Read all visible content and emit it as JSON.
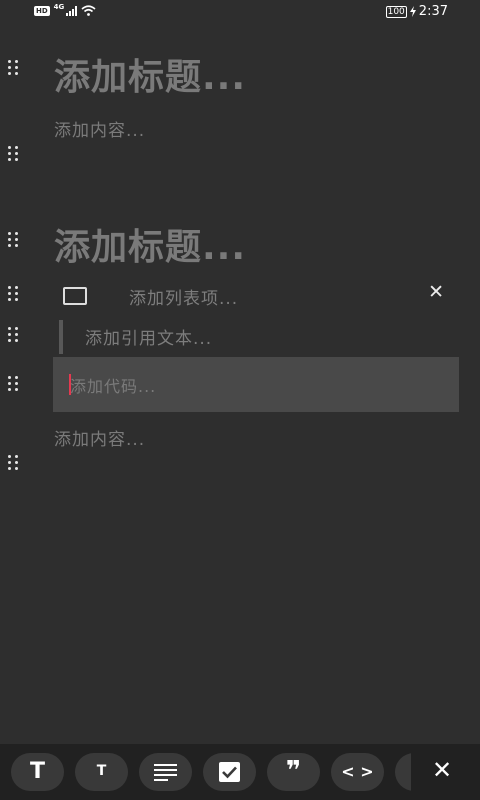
{
  "status_bar": {
    "hd": "HD",
    "network": "4G",
    "battery": "100",
    "time": "2:37"
  },
  "editor": {
    "heading_1": "添加标题...",
    "paragraph_1": "添加内容...",
    "heading_2": "添加标题...",
    "list_item": "添加列表项...",
    "quote": "添加引用文本...",
    "code": "添加代码...",
    "paragraph_2": "添加内容..."
  },
  "toolbar": {
    "heading_large": "T",
    "heading_small": "T",
    "paragraph_icon": "align-left-icon",
    "checklist_icon": "checkbox-icon",
    "quote": "❞",
    "code": "< >",
    "close": "✕"
  },
  "colors": {
    "background": "#2e2e2e",
    "toolbar": "#212121",
    "button": "#393939",
    "code_block": "#494949",
    "cursor": "#e53950",
    "placeholder_text": "#7a7a7a"
  }
}
